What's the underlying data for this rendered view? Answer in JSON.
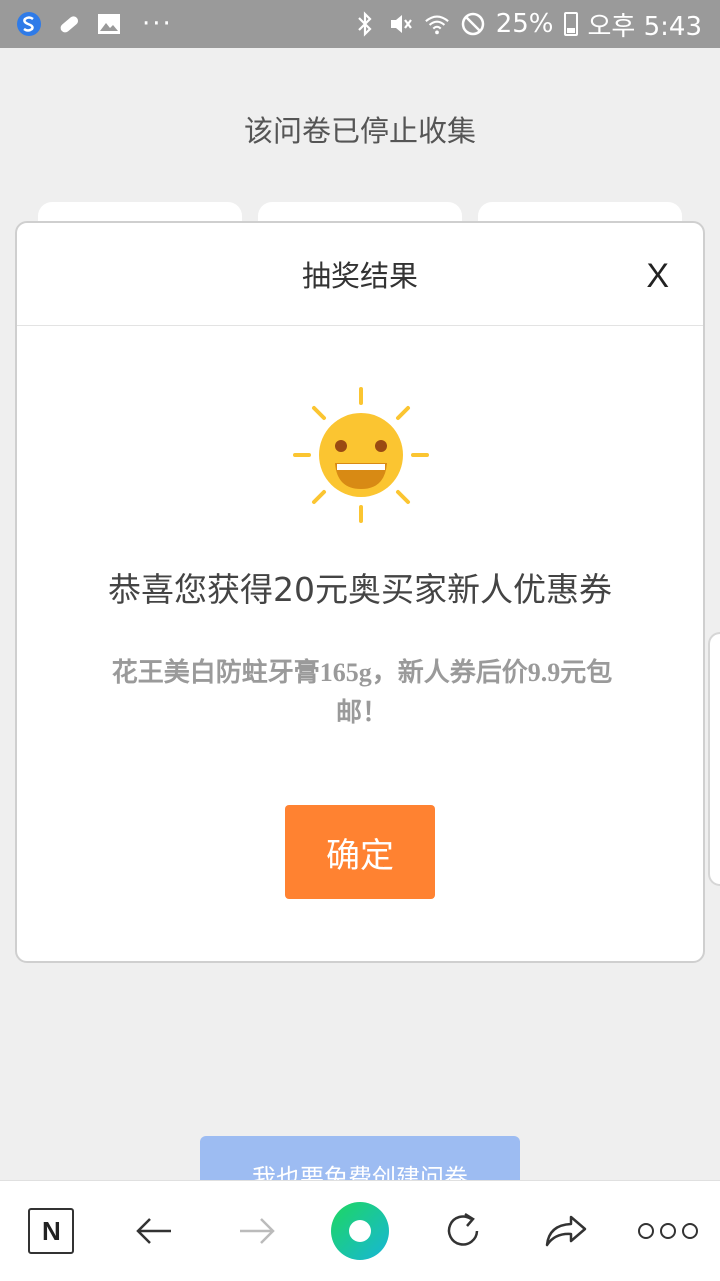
{
  "statusbar": {
    "battery": "25%",
    "time": "오후 5:43",
    "dots": "···"
  },
  "page": {
    "title": "该问卷已停止收集",
    "create_button": "我也要免费创建问卷"
  },
  "modal": {
    "title": "抽奖结果",
    "close_label": "X",
    "congrats": "恭喜您获得20元奥买家新人优惠券",
    "description": "花王美白防蛀牙膏165g，新人券后价9.9元包邮！",
    "confirm_label": "确定"
  },
  "bottombar": {
    "n_label": "N"
  },
  "colors": {
    "accent": "#ff8231",
    "sun": "#fbc531",
    "status_bar": "#9a9a9a"
  }
}
